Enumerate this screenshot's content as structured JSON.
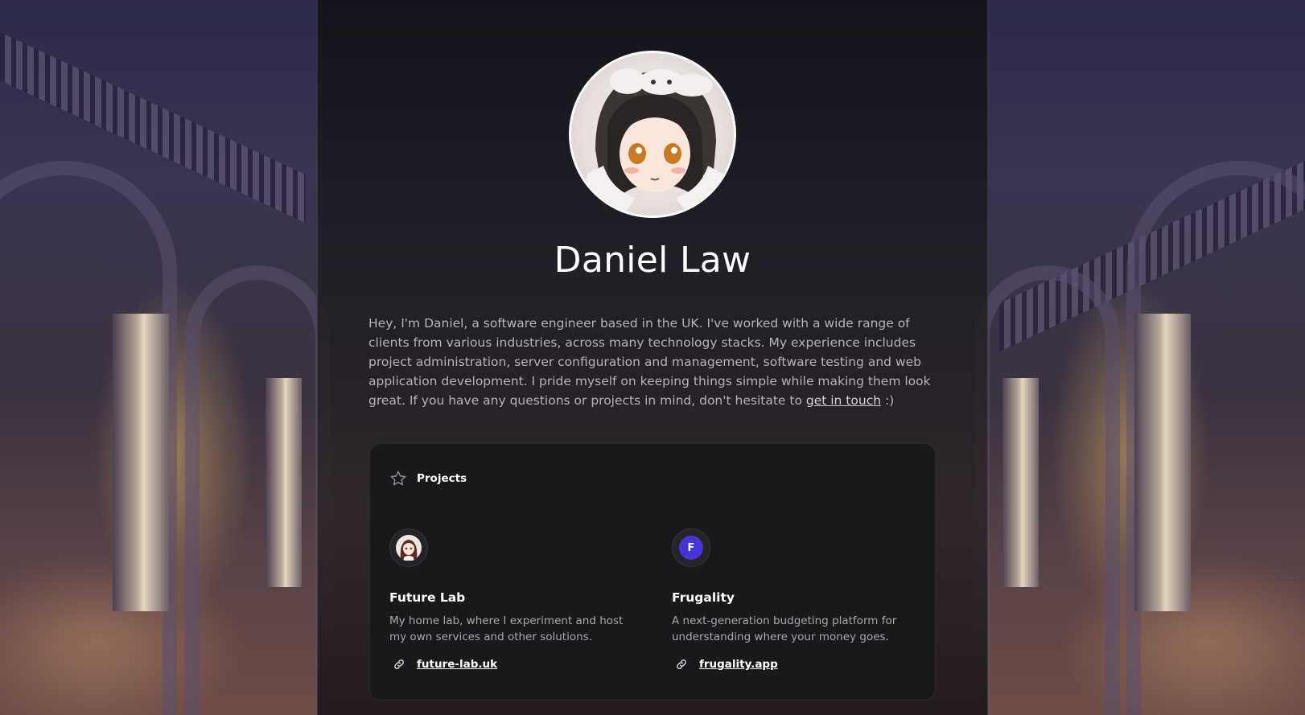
{
  "profile": {
    "name": "Daniel Law",
    "bio_text": "Hey, I'm Daniel, a software engineer based in the UK. I've worked with a wide range of clients from various industries, across many technology stacks. My experience includes project administration, server configuration and management, software testing and web application development. I pride myself on keeping things simple while making them look great. If you have any questions or projects in mind, don't hesitate to ",
    "bio_link": "get in touch",
    "bio_suffix": " :)"
  },
  "projects_card": {
    "title": "Projects",
    "icon": "star-icon",
    "items": [
      {
        "name": "Future Lab",
        "description": "My home lab, where I experiment and host my own services and other solutions.",
        "link": "future-lab.uk",
        "icon": "future-lab-logo"
      },
      {
        "name": "Frugality",
        "description": "A next-generation budgeting platform for understanding where your money goes.",
        "link": "frugality.app",
        "icon": "frugality-logo",
        "icon_letter": "F",
        "icon_color": "#4534d6"
      }
    ]
  }
}
